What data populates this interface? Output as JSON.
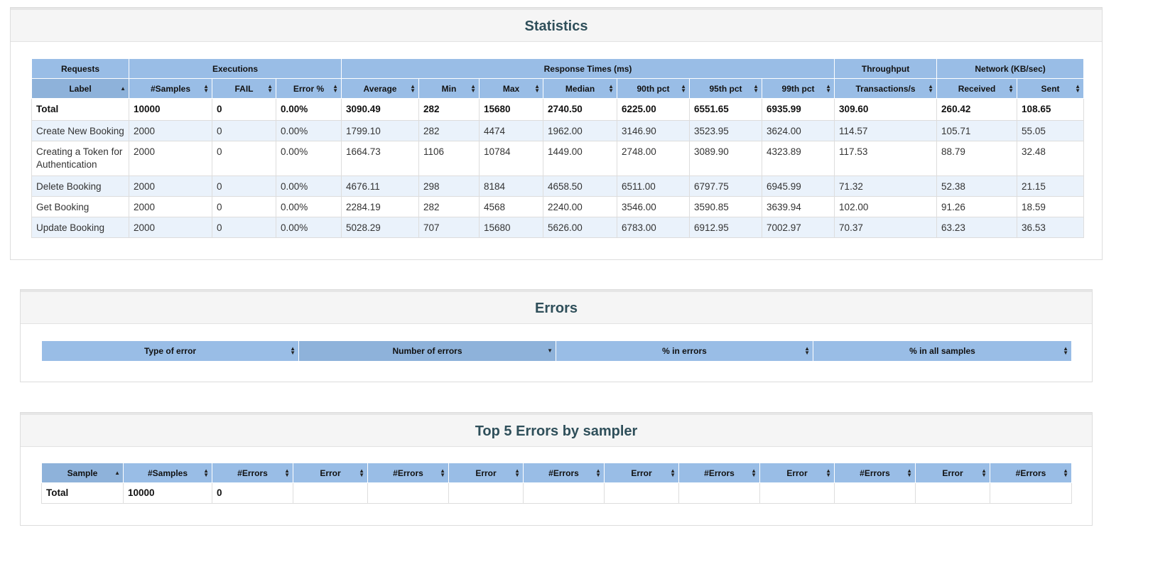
{
  "statistics": {
    "title": "Statistics",
    "groups": [
      {
        "label": "Requests",
        "span": 1
      },
      {
        "label": "Executions",
        "span": 3
      },
      {
        "label": "Response Times (ms)",
        "span": 7
      },
      {
        "label": "Throughput",
        "span": 1
      },
      {
        "label": "Network (KB/sec)",
        "span": 2
      }
    ],
    "columns": [
      "Label",
      "#Samples",
      "FAIL",
      "Error %",
      "Average",
      "Min",
      "Max",
      "Median",
      "90th pct",
      "95th pct",
      "99th pct",
      "Transactions/s",
      "Received",
      "Sent"
    ],
    "sort": {
      "column": 0,
      "direction": "asc"
    },
    "total": [
      "Total",
      "10000",
      "0",
      "0.00%",
      "3090.49",
      "282",
      "15680",
      "2740.50",
      "6225.00",
      "6551.65",
      "6935.99",
      "309.60",
      "260.42",
      "108.65"
    ],
    "rows": [
      [
        "Create New Booking",
        "2000",
        "0",
        "0.00%",
        "1799.10",
        "282",
        "4474",
        "1962.00",
        "3146.90",
        "3523.95",
        "3624.00",
        "114.57",
        "105.71",
        "55.05"
      ],
      [
        "Creating a Token for Authentication",
        "2000",
        "0",
        "0.00%",
        "1664.73",
        "1106",
        "10784",
        "1449.00",
        "2748.00",
        "3089.90",
        "4323.89",
        "117.53",
        "88.79",
        "32.48"
      ],
      [
        "Delete Booking",
        "2000",
        "0",
        "0.00%",
        "4676.11",
        "298",
        "8184",
        "4658.50",
        "6511.00",
        "6797.75",
        "6945.99",
        "71.32",
        "52.38",
        "21.15"
      ],
      [
        "Get Booking",
        "2000",
        "0",
        "0.00%",
        "2284.19",
        "282",
        "4568",
        "2240.00",
        "3546.00",
        "3590.85",
        "3639.94",
        "102.00",
        "91.26",
        "18.59"
      ],
      [
        "Update Booking",
        "2000",
        "0",
        "0.00%",
        "5028.29",
        "707",
        "15680",
        "5626.00",
        "6783.00",
        "6912.95",
        "7002.97",
        "70.37",
        "63.23",
        "36.53"
      ]
    ]
  },
  "errors": {
    "title": "Errors",
    "columns": [
      "Type of error",
      "Number of errors",
      "% in errors",
      "% in all samples"
    ],
    "sort": {
      "column": 1,
      "direction": "desc"
    },
    "rows": []
  },
  "top5": {
    "title": "Top 5 Errors by sampler",
    "columns": [
      "Sample",
      "#Samples",
      "#Errors",
      "Error",
      "#Errors",
      "Error",
      "#Errors",
      "Error",
      "#Errors",
      "Error",
      "#Errors",
      "Error",
      "#Errors"
    ],
    "sort": {
      "column": 0,
      "direction": "asc"
    },
    "total": [
      "Total",
      "10000",
      "0",
      "",
      "",
      "",
      "",
      "",
      "",
      "",
      "",
      "",
      ""
    ]
  },
  "colors": {
    "header_bg": "#99bde6",
    "sorted_header_bg": "#8eb2da",
    "odd_row_bg": "#eaf2fb",
    "panel_head_bg": "#f5f5f5",
    "title_color": "#2f4f5a"
  },
  "icons": {
    "sortable": "sort-both-icon",
    "sorted_asc": "sort-asc-icon",
    "sorted_desc": "sort-desc-icon"
  }
}
